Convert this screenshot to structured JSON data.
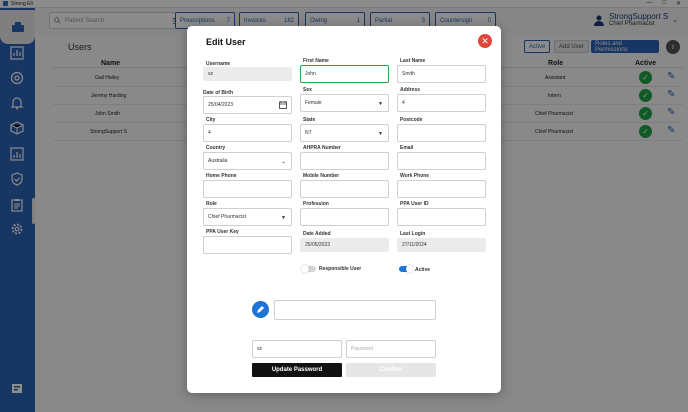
{
  "window": {
    "title": "Strong Eli",
    "controls": [
      "—",
      "□",
      "✕"
    ]
  },
  "topbar": {
    "search_placeholder": "Patient Search",
    "tabs": [
      {
        "label": "Prescriptions",
        "count": "7"
      },
      {
        "label": "Invoices",
        "count": "182"
      },
      {
        "label": "Owing",
        "count": "1"
      },
      {
        "label": "Partial",
        "count": "3"
      },
      {
        "label": "Countersign",
        "count": "0"
      }
    ],
    "user": {
      "name": "StrongSupport S",
      "role": "Chief Pharmacist"
    }
  },
  "users_page": {
    "title": "Users",
    "active_label": "Active",
    "add_user_label": "Add User",
    "roles_label": "Roles and Permissions",
    "columns": {
      "name": "Name",
      "role": "Role",
      "active": "Active"
    },
    "rows": [
      {
        "name": "Gail Hailey",
        "role": "Assistant"
      },
      {
        "name": "Jeremy Harding",
        "role": "Intern"
      },
      {
        "name": "John Smith",
        "role": "Chief Pharmacist"
      },
      {
        "name": "StrongSupport S",
        "role": "Chief Pharmacist"
      }
    ]
  },
  "modal": {
    "title": "Edit User",
    "close_glyph": "✕",
    "fields": {
      "username": {
        "label": "Username",
        "value": "sz"
      },
      "first_name": {
        "label": "First Name",
        "value": "John"
      },
      "last_name": {
        "label": "Last Name",
        "value": "Smith"
      },
      "dob": {
        "label": "Date of Birth",
        "value": "25/04/2023"
      },
      "sex": {
        "label": "Sex",
        "value": "Female"
      },
      "address": {
        "label": "Address",
        "value": "4"
      },
      "city": {
        "label": "City",
        "value": "4"
      },
      "state": {
        "label": "State",
        "value": "NT"
      },
      "postcode": {
        "label": "Postcode",
        "value": ""
      },
      "country": {
        "label": "Country",
        "value": "Australia"
      },
      "ahpra": {
        "label": "AHPRA Number",
        "value": ""
      },
      "email": {
        "label": "Email",
        "value": ""
      },
      "home_phone": {
        "label": "Home Phone",
        "value": ""
      },
      "mobile": {
        "label": "Mobile Number",
        "value": ""
      },
      "work_phone": {
        "label": "Work Phone",
        "value": ""
      },
      "role": {
        "label": "Role",
        "value": "Chief Pharmacist"
      },
      "profession": {
        "label": "Profession",
        "value": ""
      },
      "ppa_user_id": {
        "label": "PPA User ID",
        "value": ""
      },
      "ppa_user_key": {
        "label": "PPA User Key",
        "value": ""
      },
      "date_added": {
        "label": "Date Added",
        "value": "25/05/2023"
      },
      "last_login": {
        "label": "Last Login",
        "value": "27/11/2024"
      }
    },
    "toggles": {
      "responsible": {
        "label": "Responsible User",
        "on": false
      },
      "active": {
        "label": "Active",
        "on": true
      }
    },
    "signature_value": "",
    "password_user_value": "sz",
    "password_placeholder": "Password",
    "update_password_label": "Update Password",
    "confirm_label": "Confirm"
  },
  "colors": {
    "brand": "#2d63b5",
    "active_border": "#2fa03f",
    "close": "#e0463b",
    "toggle_on": "#1d74d6"
  }
}
